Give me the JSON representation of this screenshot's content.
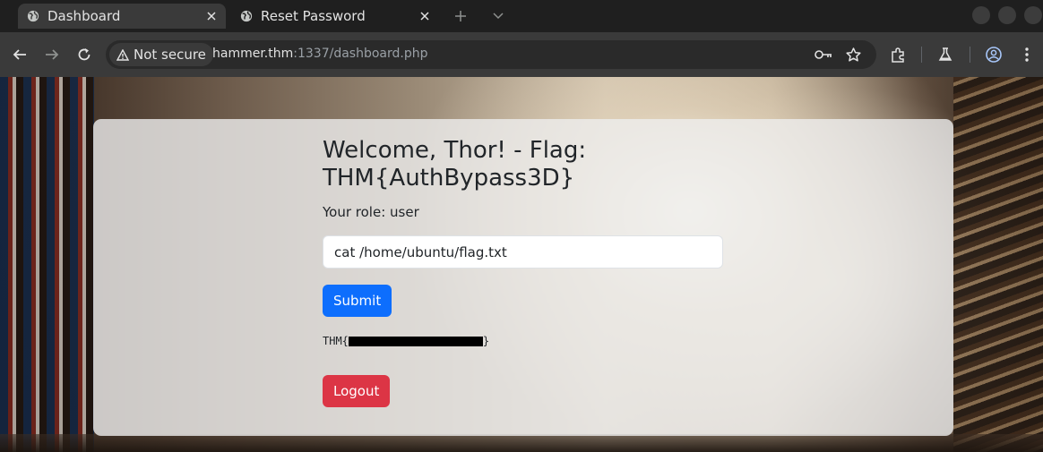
{
  "browser": {
    "tabs": [
      {
        "label": "Dashboard",
        "active": true
      },
      {
        "label": "Reset Password",
        "active": false
      }
    ],
    "security_label": "Not secure",
    "url_host": "hammer.thm",
    "url_path": ":1337/dashboard.php"
  },
  "page": {
    "welcome_heading": "Welcome, Thor! - Flag: THM{AuthBypass3D}",
    "role_line": "Your role: user",
    "command_value": "cat /home/ubuntu/flag.txt",
    "submit_label": "Submit",
    "output_prefix": "THM{",
    "output_suffix": "}",
    "logout_label": "Logout"
  },
  "colors": {
    "submit": "#0d6efd",
    "logout": "#dc3545",
    "toolbar": "#3a3a3a",
    "tabstrip": "#1f1f1f"
  },
  "icons": [
    "globe-icon",
    "close-icon",
    "plus-icon",
    "chevron-down-icon",
    "back-arrow-icon",
    "forward-arrow-icon",
    "reload-icon",
    "warning-triangle-icon",
    "key-icon",
    "star-icon",
    "extensions-icon",
    "labs-flask-icon",
    "profile-icon",
    "kebab-menu-icon"
  ]
}
